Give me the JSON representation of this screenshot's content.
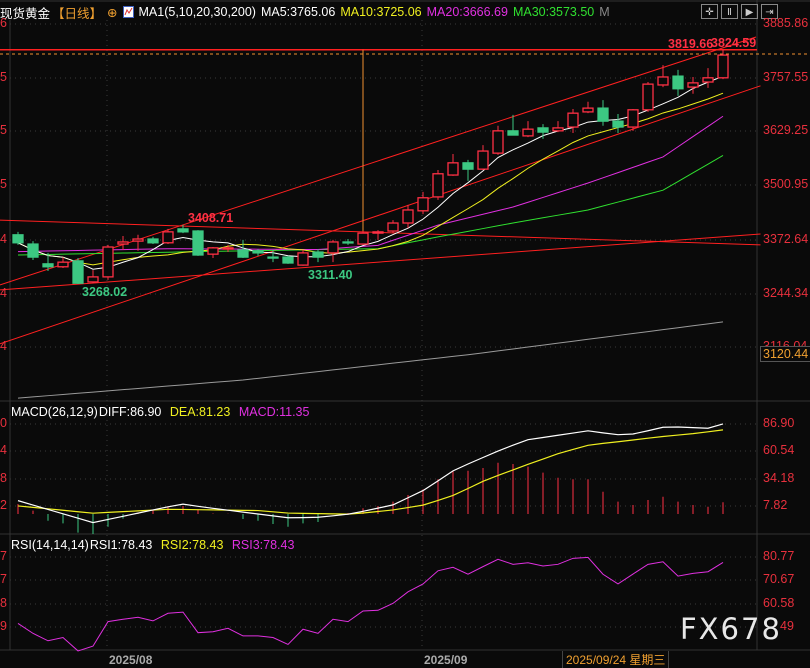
{
  "header": {
    "instrument": "现货黄金",
    "period": "【日线】",
    "ma_title": "MA1(5,10,20,30,200)",
    "ma5": "MA5:3765.06",
    "ma10": "MA10:3725.06",
    "ma20": "MA20:3666.69",
    "ma30": "MA30:3573.50",
    "more": "M",
    "toolbar": [
      "crosshair",
      "bars",
      "play",
      "exit"
    ]
  },
  "colors": {
    "up": "#ff3044",
    "down": "#3cc882",
    "ma5": "#ffffff",
    "ma10": "#f0f020",
    "ma20": "#e030e0",
    "ma30": "#30e030",
    "ma200": "#9a9a9a",
    "axis": "#e8303d",
    "accent": "#f09030"
  },
  "chart_data": [
    {
      "type": "candlestick",
      "title": "",
      "y_ticks": [
        "3885.86",
        "3757.55",
        "3629.25",
        "3500.95",
        "3372.64",
        "3244.34",
        "3116.04"
      ],
      "left_tick_fragments": [
        "6",
        "5",
        "5",
        "5",
        "4",
        "4",
        "4"
      ],
      "current_marker": "3120.44",
      "ohlc": [
        [
          3385,
          3392,
          3361,
          3366
        ],
        [
          3363,
          3370,
          3325,
          3332
        ],
        [
          3316,
          3342,
          3299,
          3309
        ],
        [
          3309,
          3332,
          3306,
          3320
        ],
        [
          3323,
          3330,
          3268.02,
          3270
        ],
        [
          3273,
          3301,
          3270,
          3285
        ],
        [
          3285,
          3361,
          3278,
          3356
        ],
        [
          3363,
          3382,
          3349,
          3368
        ],
        [
          3370,
          3385,
          3347,
          3375
        ],
        [
          3375,
          3380,
          3363,
          3366
        ],
        [
          3366,
          3399,
          3363,
          3392
        ],
        [
          3399,
          3408.71,
          3389,
          3392
        ],
        [
          3394,
          3396,
          3335,
          3337
        ],
        [
          3339,
          3356,
          3330,
          3354
        ],
        [
          3351,
          3361,
          3344,
          3354
        ],
        [
          3349,
          3373,
          3330,
          3332
        ],
        [
          3347,
          3351,
          3335,
          3342
        ],
        [
          3332,
          3349,
          3320,
          3330
        ],
        [
          3332,
          3335,
          3316,
          3318
        ],
        [
          3313,
          3349,
          3311.4,
          3342
        ],
        [
          3344,
          3351,
          3320,
          3332
        ],
        [
          3342,
          3373,
          3320,
          3368
        ],
        [
          3368,
          3375,
          3361,
          3366
        ],
        [
          3363,
          3394,
          3361,
          3389
        ],
        [
          3389,
          3396,
          3373,
          3392
        ],
        [
          3394,
          3420,
          3389,
          3413
        ],
        [
          3413,
          3456,
          3401,
          3444
        ],
        [
          3442,
          3487,
          3434,
          3473
        ],
        [
          3475,
          3539,
          3468,
          3530
        ],
        [
          3527,
          3577,
          3525,
          3556
        ],
        [
          3556,
          3563,
          3513,
          3541
        ],
        [
          3541,
          3598,
          3539,
          3584
        ],
        [
          3579,
          3644,
          3575,
          3632
        ],
        [
          3632,
          3670,
          3622,
          3622
        ],
        [
          3620,
          3655,
          3617,
          3636
        ],
        [
          3639,
          3648,
          3613,
          3629
        ],
        [
          3632,
          3655,
          3629,
          3639
        ],
        [
          3641,
          3684,
          3627,
          3674
        ],
        [
          3677,
          3701,
          3674,
          3686
        ],
        [
          3686,
          3705,
          3644,
          3655
        ],
        [
          3655,
          3672,
          3627,
          3641
        ],
        [
          3641,
          3684,
          3632,
          3682
        ],
        [
          3682,
          3748,
          3677,
          3743
        ],
        [
          3741,
          3788,
          3736,
          3760
        ],
        [
          3762,
          3777,
          3715,
          3732
        ],
        [
          3736,
          3760,
          3720,
          3746
        ],
        [
          3748,
          3781,
          3734,
          3758
        ],
        [
          3758,
          3824.59,
          3755,
          3812
        ]
      ],
      "ma20_points": [
        [
          0,
          3345
        ],
        [
          10,
          3352
        ],
        [
          20,
          3350
        ],
        [
          24,
          3360
        ],
        [
          28,
          3408
        ],
        [
          33,
          3451
        ],
        [
          38,
          3508
        ],
        [
          43,
          3570
        ],
        [
          47,
          3666.69
        ]
      ],
      "ma30_points": [
        [
          0,
          3337
        ],
        [
          12,
          3345
        ],
        [
          24,
          3352
        ],
        [
          28,
          3380
        ],
        [
          33,
          3413
        ],
        [
          38,
          3444
        ],
        [
          43,
          3491
        ],
        [
          47,
          3573.5
        ]
      ],
      "ma200_points": [
        [
          0,
          2997
        ],
        [
          15,
          3040
        ],
        [
          30,
          3100
        ],
        [
          47,
          3178
        ]
      ],
      "trendlines": [
        [
          [
            -1.2,
            3266
          ],
          [
            49.2,
            3855
          ]
        ],
        [
          [
            -1.2,
            3126
          ],
          [
            49.5,
            3739
          ]
        ],
        [
          [
            -1.2,
            3420
          ],
          [
            49.5,
            3361
          ]
        ],
        [
          [
            -1.2,
            3254
          ],
          [
            49.5,
            3387
          ]
        ]
      ],
      "resistance_level": 3824.59,
      "last_price_level": 3814.6,
      "marker_index": 23,
      "annotations": [
        {
          "text": "3408.71",
          "index": 11,
          "kind": "high"
        },
        {
          "text": "3268.02",
          "index": 4,
          "kind": "low"
        },
        {
          "text": "3311.40",
          "index": 19,
          "kind": "low"
        },
        {
          "text": "3819.66",
          "index": 43,
          "kind": "high"
        },
        {
          "text": "3824.59",
          "index": 47,
          "kind": "high"
        }
      ],
      "x_labels": [
        "2025/08",
        "2025/09",
        "2025/09/24 星期三"
      ]
    },
    {
      "type": "macd",
      "title": "MACD(26,12,9)",
      "diff_label": "DIFF:86.90",
      "dea_label": "DEA:81.23",
      "macd_label": "MACD:11.35",
      "y_ticks": [
        "86.90",
        "60.54",
        "34.18",
        "7.82"
      ],
      "left_tick_fragments": [
        "0",
        "4",
        "8",
        "2"
      ],
      "diff_points": [
        [
          0,
          12.9
        ],
        [
          5,
          -8.3
        ],
        [
          10.9,
          9.7
        ],
        [
          12.6,
          6.2
        ],
        [
          18.1,
          -3.8
        ],
        [
          20.1,
          -3.1
        ],
        [
          22.2,
          0.1
        ],
        [
          25,
          8.8
        ],
        [
          27.1,
          23.3
        ],
        [
          29.1,
          42.6
        ],
        [
          31.9,
          60.2
        ],
        [
          33.9,
          71.5
        ],
        [
          38.1,
          80.5
        ],
        [
          39.8,
          76.4
        ],
        [
          41.1,
          77.3
        ],
        [
          43.2,
          84.4
        ],
        [
          46,
          82.8
        ],
        [
          47,
          86.9
        ]
      ],
      "dea_points": [
        [
          0,
          7.8
        ],
        [
          5,
          0.8
        ],
        [
          10.1,
          4.6
        ],
        [
          16,
          3.3
        ],
        [
          18.1,
          0.8
        ],
        [
          22.2,
          -0.2
        ],
        [
          25,
          3.9
        ],
        [
          27.1,
          8.8
        ],
        [
          29.1,
          18.4
        ],
        [
          31.2,
          32.9
        ],
        [
          33.9,
          47.4
        ],
        [
          36.1,
          58.7
        ],
        [
          38.1,
          66.7
        ],
        [
          40.1,
          69.9
        ],
        [
          42.9,
          74.7
        ],
        [
          45.3,
          78.0
        ],
        [
          47,
          81.23
        ]
      ],
      "histogram": [
        9.7,
        3.2,
        -6.5,
        -9,
        -18,
        -19.3,
        -12.3,
        -4.5,
        1.3,
        3.9,
        7,
        7.7,
        4.5,
        0.5,
        0.3,
        -4.8,
        -6.5,
        -9.7,
        -12.3,
        -9,
        -7.7,
        0,
        1,
        5.5,
        7.7,
        11.9,
        18.3,
        23.8,
        33.5,
        41.8,
        41.8,
        44.4,
        49.5,
        48.3,
        45.7,
        39.9,
        35,
        33.5,
        33.5,
        21.5,
        11.9,
        8.7,
        13.5,
        16.7,
        11.9,
        8.7,
        7,
        11.35
      ]
    },
    {
      "type": "line",
      "title": "RSI(14,14,14)",
      "rsi1_label": "RSI1:78.43",
      "rsi2_label": "RSI2:78.43",
      "rsi3_label": "RSI3:78.43",
      "y_ticks": [
        "80.77",
        "70.67",
        "60.58",
        "49"
      ],
      "left_tick_fragments": [
        "7",
        "7",
        "8",
        "9"
      ],
      "values": [
        52.0,
        47.7,
        44.5,
        45.9,
        40.1,
        42.2,
        52.8,
        53.8,
        54.7,
        53.1,
        56.4,
        56.9,
        48.0,
        48.4,
        49.9,
        46.6,
        46.6,
        45.9,
        42.9,
        49.5,
        47.7,
        53.8,
        52.8,
        57.4,
        57.7,
        60.7,
        65.7,
        69.1,
        74.8,
        76.3,
        73.3,
        76.6,
        79.8,
        77.6,
        78.3,
        76.9,
        77.6,
        80.2,
        80.6,
        73.3,
        69.1,
        73.4,
        77.6,
        78.7,
        72.5,
        73.7,
        74.4,
        78.43
      ]
    }
  ],
  "watermark": "FX678"
}
